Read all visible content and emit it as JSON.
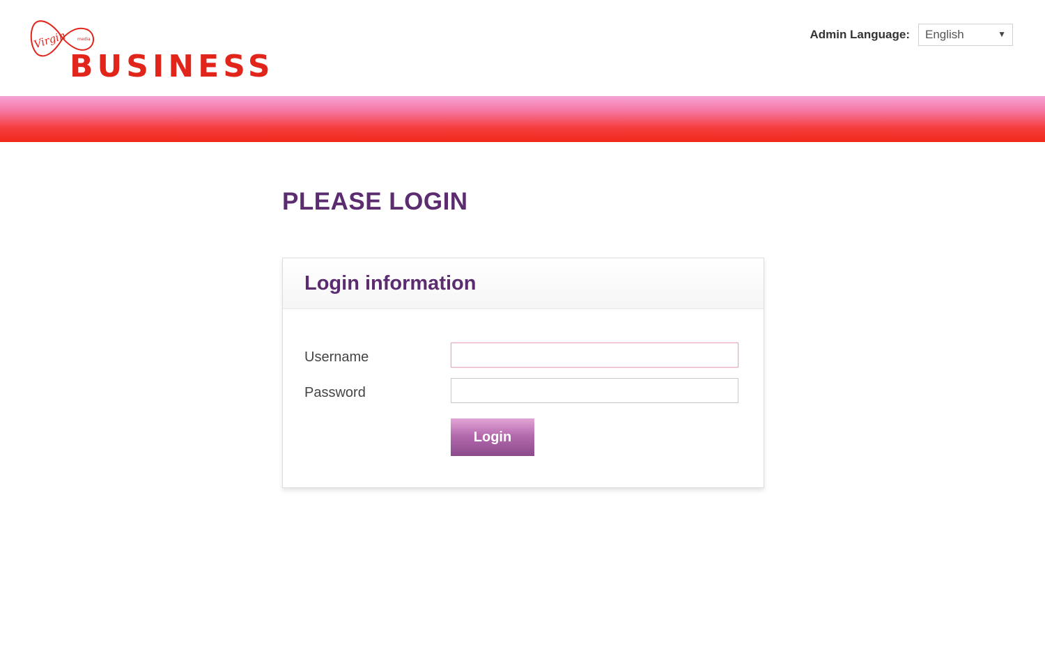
{
  "header": {
    "logo": {
      "script_text": "Virgin",
      "small_text": "media",
      "wordmark": "BUSINESS"
    },
    "admin_language": {
      "label": "Admin Language:",
      "selected": "English"
    }
  },
  "main": {
    "title": "PLEASE LOGIN",
    "panel": {
      "title": "Login information",
      "username_label": "Username",
      "username_value": "",
      "password_label": "Password",
      "password_value": "",
      "login_button": "Login"
    }
  },
  "colors": {
    "brand_red": "#e1251b",
    "heading_purple": "#5b2c6f",
    "band_top": "#f7a3d6",
    "band_bottom": "#f0281a",
    "button_top": "#e3a6d6",
    "button_bottom": "#8b4a8c"
  },
  "icons": {
    "logo_mark": "virgin-media-infinity-logo-icon",
    "dropdown": "triangle-down-icon"
  }
}
